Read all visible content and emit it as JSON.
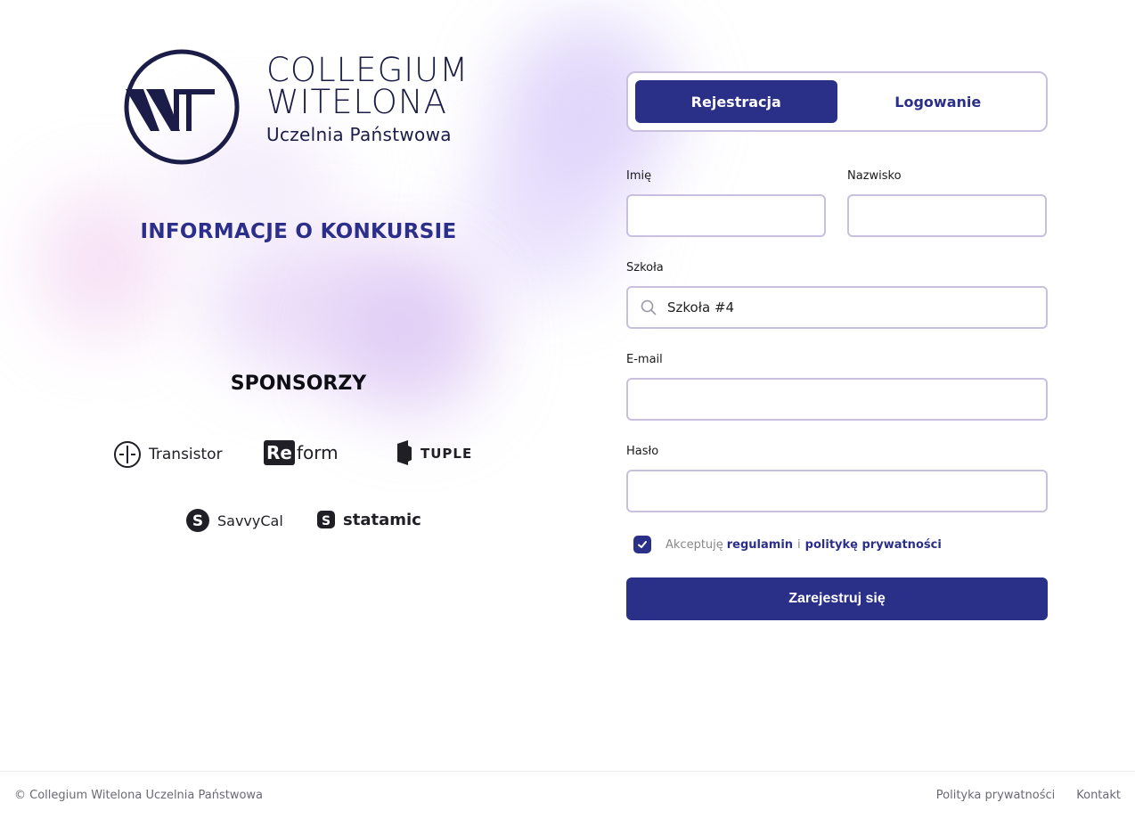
{
  "brand": {
    "line1": "COLLEGIUM",
    "line2": "WITELONA",
    "line3": "Uczelnia Państwowa"
  },
  "left": {
    "info_link": "INFORMACJE O KONKURSIE",
    "sponsors_title": "SPONSORZY",
    "sponsors": [
      {
        "name": "Transistor",
        "icon": "transistor-logo-icon"
      },
      {
        "name": "Re",
        "name2": "form",
        "icon": "reform-logo-icon"
      },
      {
        "name": "TUPLE",
        "icon": "tuple-logo-icon"
      },
      {
        "name": "SavvyCal",
        "icon": "savvycal-logo-icon"
      },
      {
        "name": "statamic",
        "icon": "statamic-logo-icon"
      }
    ]
  },
  "tabs": [
    {
      "label": "Rejestracja",
      "active": true
    },
    {
      "label": "Logowanie",
      "active": false
    }
  ],
  "form": {
    "first_name_label": "Imię",
    "first_name_value": "",
    "last_name_label": "Nazwisko",
    "last_name_value": "",
    "school_label": "Szkoła",
    "school_value": "Szkoła #4",
    "email_label": "E-mail",
    "email_value": "",
    "password_label": "Hasło",
    "password_value": "",
    "consent_prefix": "Akceptuję",
    "consent_terms": "regulamin",
    "consent_and": "i",
    "consent_privacy": "politykę prywatności",
    "consent_checked": true,
    "submit_label": "Zarejestruj się"
  },
  "footer": {
    "copyright": "© Collegium Witelona Uczelnia Państwowa",
    "links": [
      "Polityka prywatności",
      "Kontakt"
    ]
  },
  "colors": {
    "primary": "#2a2f87",
    "logo": "#1b1c47",
    "border": "#c8c0de"
  }
}
